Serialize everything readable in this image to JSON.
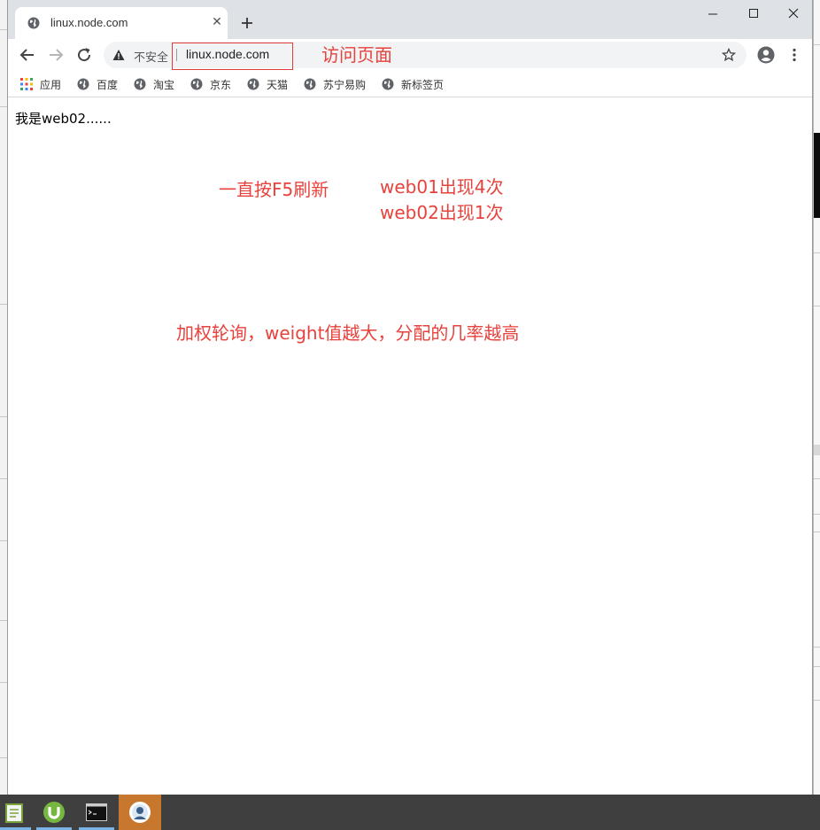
{
  "browser": {
    "tab": {
      "title": "linux.node.com"
    },
    "address_bar": {
      "security_label": "不安全",
      "url": "linux.node.com"
    }
  },
  "bookmarks": [
    {
      "label": "应用",
      "icon": "apps-grid-icon"
    },
    {
      "label": "百度",
      "icon": "globe-icon"
    },
    {
      "label": "淘宝",
      "icon": "globe-icon"
    },
    {
      "label": "京东",
      "icon": "globe-icon"
    },
    {
      "label": "天猫",
      "icon": "globe-icon"
    },
    {
      "label": "苏宁易购",
      "icon": "globe-icon"
    },
    {
      "label": "新标签页",
      "icon": "globe-icon"
    }
  ],
  "page": {
    "body_text": "我是web02......"
  },
  "annotations": {
    "visit_page": "访问页面",
    "refresh_note": "一直按F5刷新",
    "web01_count": "web01出现4次",
    "web02_count": "web02出现1次",
    "weight_note": "加权轮询，weight值越大，分配的几率越高"
  },
  "colors": {
    "annotation": "#e8423c",
    "tabstrip": "#dee1e6",
    "omnibox": "#f1f3f4",
    "taskbar": "#3f3f3f"
  }
}
